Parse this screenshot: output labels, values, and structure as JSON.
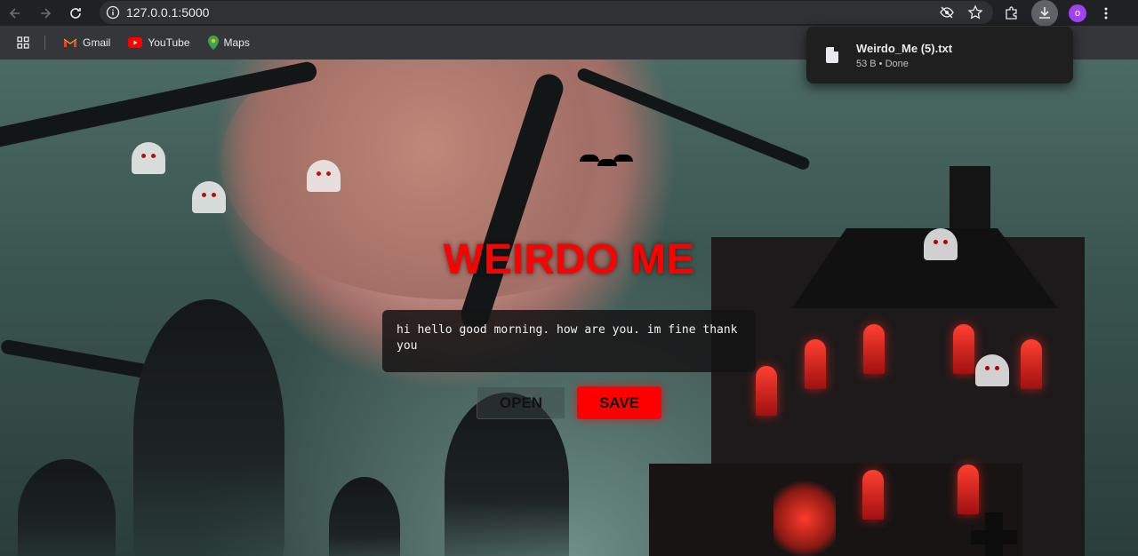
{
  "browser": {
    "url": "127.0.0.1:5000",
    "nav": {
      "back_icon": "arrow-left-icon",
      "forward_icon": "arrow-right-icon",
      "reload_icon": "reload-icon"
    },
    "avatar_letter": "o"
  },
  "bookmarks": [
    {
      "label": "Gmail",
      "icon": "gmail-icon"
    },
    {
      "label": "YouTube",
      "icon": "youtube-icon"
    },
    {
      "label": "Maps",
      "icon": "maps-icon"
    }
  ],
  "download": {
    "filename": "Weirdo_Me (5).txt",
    "status": "53 B • Done"
  },
  "app": {
    "title": "WEIRDO ME",
    "editor_text": "hi hello good morning. how are you. im fine thank you",
    "open_label": "OPEN",
    "save_label": "SAVE",
    "colors": {
      "title": "#ff0000",
      "save_bg": "#ff0000"
    }
  }
}
